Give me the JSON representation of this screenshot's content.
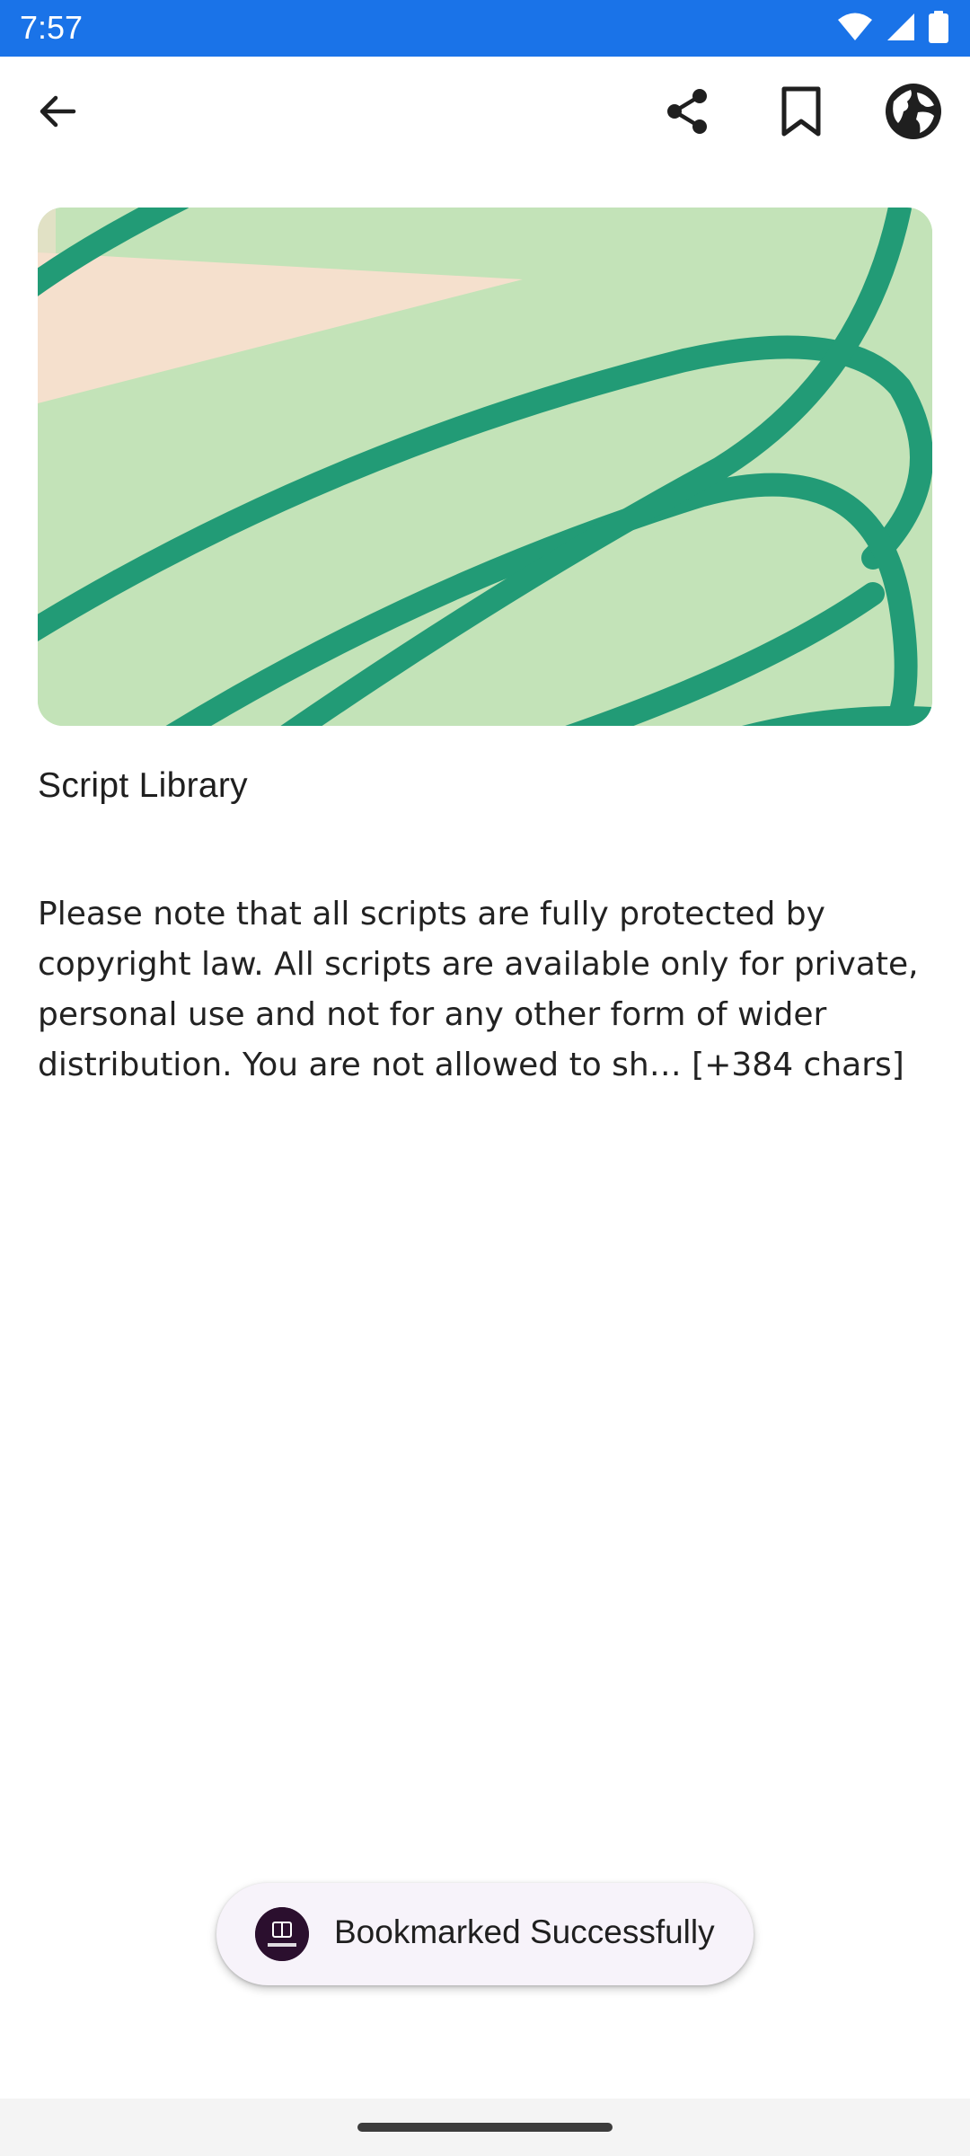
{
  "status_bar": {
    "time": "7:57",
    "icons": [
      "wifi-icon",
      "signal-icon",
      "battery-icon"
    ],
    "background": "#1a73e8"
  },
  "app_bar": {
    "back_icon": "arrow-back-icon",
    "actions": [
      "share-icon",
      "bookmark-icon",
      "globe-icon"
    ]
  },
  "hero": {
    "colors": {
      "background": "#c3e3b8",
      "stroke": "#229b76",
      "accent": "#f5e0cd"
    }
  },
  "article": {
    "title": "Script Library",
    "body": "Please note that all scripts are fully protected by copyright law. All scripts are available only for private, personal use and not for any other form of wider distribution. You are not allowed to sh… [+384 chars]"
  },
  "toast": {
    "message": "Bookmarked Successfully",
    "app_icon_label": "JOURNAL"
  },
  "nav_bar": {
    "handle": "gesture-handle"
  }
}
